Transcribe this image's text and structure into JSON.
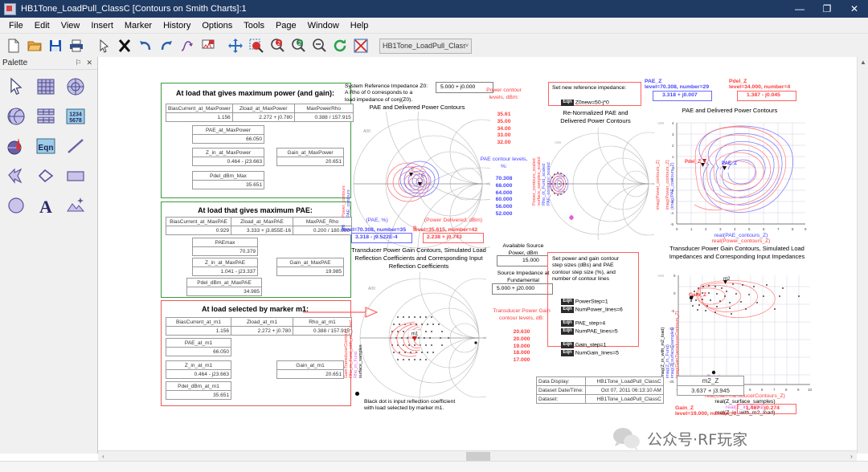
{
  "window": {
    "title": "HB1Tone_LoadPull_ClassC [Contours on Smith Charts]:1",
    "icon": "ads-app-icon",
    "minimize": "—",
    "maximize": "❐",
    "close": "✕"
  },
  "menu": [
    "File",
    "Edit",
    "View",
    "Insert",
    "Marker",
    "History",
    "Options",
    "Tools",
    "Page",
    "Window",
    "Help"
  ],
  "toolbar": {
    "buttons": [
      {
        "name": "new-icon",
        "glyph": "new"
      },
      {
        "name": "open-icon",
        "glyph": "open"
      },
      {
        "name": "save-icon",
        "glyph": "save"
      },
      {
        "name": "print-icon",
        "glyph": "print"
      },
      {
        "name": "select-arrow-icon",
        "glyph": "arrow"
      },
      {
        "name": "delete-icon",
        "glyph": "x"
      },
      {
        "name": "undo-icon",
        "glyph": "undo"
      },
      {
        "name": "redo-icon",
        "glyph": "redo"
      },
      {
        "name": "trace-icon",
        "glyph": "trace"
      },
      {
        "name": "marker-icon",
        "glyph": "marker"
      },
      {
        "name": "pan-icon",
        "glyph": "pan"
      },
      {
        "name": "zoom-area-icon",
        "glyph": "zoomarea"
      },
      {
        "name": "zoom-in-icon",
        "glyph": "zoomin"
      },
      {
        "name": "zoom-out-icon",
        "glyph": "zoomout"
      },
      {
        "name": "zoom-full-icon",
        "glyph": "zoomfull"
      },
      {
        "name": "refresh-icon",
        "glyph": "refresh"
      },
      {
        "name": "stop-icon",
        "glyph": "stop"
      }
    ],
    "dataset_combo": {
      "value": "HB1Tone_LoadPull_ClassC",
      "arrow": "˅"
    }
  },
  "palette": {
    "title": "Palette",
    "pin": "⚐",
    "close": "✕",
    "items": [
      {
        "name": "pointer-tool-icon",
        "glyph": "pointer"
      },
      {
        "name": "rectangular-plot-icon",
        "glyph": "grid"
      },
      {
        "name": "polar-plot-icon",
        "glyph": "polar"
      },
      {
        "name": "smith-chart-icon",
        "glyph": "smith"
      },
      {
        "name": "list-table-icon",
        "glyph": "table"
      },
      {
        "name": "stacked-table-icon",
        "glyph": "digits",
        "label": "1234\n5678"
      },
      {
        "name": "antenna-plot-icon",
        "glyph": "antenna"
      },
      {
        "name": "equation-tool-icon",
        "glyph": "eqn",
        "label": "Eqn"
      },
      {
        "name": "line-tool-icon",
        "glyph": "line"
      },
      {
        "name": "arrow-shape-icon",
        "glyph": "arrowshape"
      },
      {
        "name": "polyline-tool-icon",
        "glyph": "polyline"
      },
      {
        "name": "rectangle-tool-icon",
        "glyph": "rect"
      },
      {
        "name": "ellipse-tool-icon",
        "glyph": "ellipse"
      },
      {
        "name": "text-tool-icon",
        "glyph": "text",
        "label": "A"
      },
      {
        "name": "image-tool-icon",
        "glyph": "image"
      }
    ]
  },
  "doc": {
    "max_power_group": {
      "title": "At load that gives maximum power (and gain):",
      "row1": {
        "headers": [
          "BiasCurrent_at_MaxPower",
          "Zload_at_MaxPower",
          "MaxPowerRho"
        ],
        "values": [
          "1.156",
          "2.272 + j0.780",
          "0.388 / 157.915"
        ]
      },
      "pae": {
        "header": "PAE_at_MaxPower",
        "value": "66.050"
      },
      "zin": {
        "header": "Z_in_at_MaxPower",
        "value": "0.464 - j23.663"
      },
      "gain": {
        "header": "Gain_at_MaxPower",
        "value": "20.651"
      },
      "pdel": {
        "header": "Pdel_dBm_Max",
        "value": "35.651"
      }
    },
    "max_pae_group": {
      "title": "At load that gives maximum PAE:",
      "row1": {
        "headers": [
          "BiasCurrent_at_MaxPAE",
          "Zload_at_MaxPAE",
          "MaxPAE_Rho"
        ],
        "values": [
          "0.929",
          "3.333 + j3.855E-16",
          "0.200 / 180.000"
        ]
      },
      "pae": {
        "header": "PAEmax",
        "value": "70.379"
      },
      "zin": {
        "header": "Z_in_at_MaxPAE",
        "value": "1.041 - j23.337"
      },
      "gain": {
        "header": "Gain_at_MaxPAE",
        "value": "19.985"
      },
      "pdel": {
        "header": "Pdel_dBm_at_MaxPAE",
        "value": "34.985"
      }
    },
    "marker_group": {
      "title": "At load selected by marker m1:",
      "row1": {
        "headers": [
          "BiasCurrent_at_m1",
          "Zload_at_m1",
          "Rho_at_m1"
        ],
        "values": [
          "1.156",
          "2.272 + j0.780",
          "0.388 / 157.915"
        ]
      },
      "pae": {
        "header": "PAE_at_m1",
        "value": "66.050"
      },
      "zin": {
        "header": "Z_in_at_m1",
        "value": "0.464 - j23.663"
      },
      "gain": {
        "header": "Gain_at_m1",
        "value": "20.651"
      },
      "pdel": {
        "header": "Pdel_dBm_at_m1",
        "value": "35.651"
      }
    },
    "z0_note": "System Reference Impedance Z0:\nA Rho of 0 corresponds to a\nload impedance of conj(Z0).",
    "z0_value": "5.000 + j0.000",
    "chart1_title": "PAE and Delivered Power Contours",
    "power_levels_label": "Power\ncontour\nlevels, dBm:",
    "power_levels": [
      "35.61",
      "35.00",
      "34.00",
      "33.00",
      "32.00"
    ],
    "pae_levels_label": "PAE contour\nlevels, %:",
    "pae_levels": [
      "70.308",
      "68.000",
      "64.000",
      "60.000",
      "56.000",
      "52.000"
    ],
    "chart1_ylabels": "Power_contours\nPAE_contours",
    "chart2_vlabels": "Power_contours_scaled\nsurface_samples_scaled\nRho_(it_Fund_scaled\nPAE_contours_scaled",
    "marker_E": {
      "title": "(PAE, %)",
      "tag": "E",
      "level": "level=70.308, number=35",
      "value": "3.318 - j9.522E-4"
    },
    "marker_p": {
      "title": "(Power Delivered, dBm)",
      "tag": "p",
      "level": "level=35.615, number=42",
      "value": "2.238 + j0.743"
    },
    "chart3_title": "Transducer Power Gain Contours,\nSimulated Load Reflection Coefficients and\nCorresponding Input Reflection Coefficients",
    "chart3_vlabels": "GainTransducerContours\nRho_in_Fund_with_m1_Load\nRho_in_Fund\nsurface_samples",
    "blackdot_note": "Black dot is input reflection coefficient\nwith load selected by marker m1.",
    "avail_src_label": "Available Source\nPower, dBm",
    "avail_src_value": "15.000",
    "src_imp_label": "Source Impedance\nat Fundamental",
    "src_imp_value": "5.000 + j20.000",
    "gain_levels_label": "Transducer\nPower Gain\ncontour levels, dB:",
    "gain_levels": [
      "20.630",
      "20.000",
      "19.000",
      "18.000",
      "17.000"
    ],
    "new_ref_label": "Set new reference impedance:",
    "new_ref_eqn": "Z0new=50-j*0",
    "chart2_title": "Re-Normalized PAE and\nDelivered Power Contours",
    "contour_settings_label": "Set power and gain contour\nstep sizes (dBs) and PAE\ncontour step size (%), and\nnumber of contour lines",
    "contour_settings": [
      {
        "eqn": "Eqn",
        "text": "PowerStep=1"
      },
      {
        "eqn": "Eqn",
        "text": "NumPower_lines=6"
      },
      {
        "eqn": "Eqn",
        "text": "PAE_step=4"
      },
      {
        "eqn": "Eqn",
        "text": "NumPAE_lines=5"
      },
      {
        "eqn": "Eqn",
        "text": "Gain_step=1"
      },
      {
        "eqn": "Eqn",
        "text": "NumGain_lines=5"
      }
    ],
    "marker_PAE_Z": {
      "tag": "PAE_Z",
      "level": "level=70.308, number=29",
      "value": "3.318 + j0.007"
    },
    "marker_Pdel_Z": {
      "tag": "Pdel_Z",
      "level": "level=34.000, number=4",
      "value": "1.387 - j0.045"
    },
    "chart4_title": "PAE and Delivered Power Contours",
    "chart4_xlabel": "real(PAE_contours_Z)\nreal(Power_contours_Z)",
    "chart4_ylabel": "imag(Power_contours_Z)\nimag(PAE_contours_Z)",
    "chart4_marker_pdel": "Pdel_Z",
    "chart4_marker_pae": "PAE_Z",
    "chart5_title": "Transducer Power Gain Contours,\nSimulated Load Impedances and\nCorresponding Input Impedances",
    "chart5_xlabel": "real(GainTransducerContours_Z)\nreal(Z_surface_samples)\nreal(Z_in_Fund)\nreal(Z_in_with_m2_load)",
    "chart5_ylabel": "imag(Z_in_with_m2_load)\nimag(Z_in_Fund)\nimag(Z_surface_samples)\nimag(GainTransducerContours_Z)",
    "chart5_marker": "Gain_Z",
    "chart5_m2": "m2",
    "data_display": {
      "rows": [
        {
          "label": "Data Display:",
          "value": "HB1Tone_LoadPull_ClassC"
        },
        {
          "label": "Dataset Date/Time:",
          "value": "Oct 07, 2011  06:13:10 AM"
        },
        {
          "label": "Dataset:",
          "value": "HB1Tone_LoadPull_ClassC"
        }
      ]
    },
    "m2_z": {
      "header": "m2_Z",
      "value": "3.637 + j3.945"
    },
    "gain_z_marker": {
      "tag": "Gain_Z",
      "level": "level=19.000, number=5",
      "value": "1.467 - j0.274"
    },
    "watermark": {
      "icon": "wechat-icon",
      "text": "公众号·RF玩家"
    }
  },
  "chart_data": [
    {
      "type": "scatter",
      "id": "chart4",
      "title": "PAE and Delivered Power Contours",
      "xlabel": "real(PAE_contours_Z) / real(Power_contours_Z)",
      "ylabel": "imag(Power_contours_Z) / imag(PAE_contours_Z)",
      "xlim": [
        0,
        9
      ],
      "ylim": [
        -5,
        4
      ],
      "xticks": [
        0,
        1,
        2,
        3,
        4,
        5,
        6,
        7,
        8,
        9
      ],
      "yticks": [
        -5,
        -4,
        -3,
        -2,
        -1,
        0,
        1,
        2,
        3,
        4
      ],
      "grid": true,
      "markers": [
        {
          "label": "Pdel_Z",
          "x": 1.387,
          "y": -0.045,
          "color": "#ff4040"
        },
        {
          "label": "PAE_Z",
          "x": 3.318,
          "y": 0.007,
          "color": "#4040ff"
        }
      ],
      "series": [
        {
          "name": "PAE_contours_Z",
          "color": "#6a6aff"
        },
        {
          "name": "Power_contours_Z",
          "color": "#ff7070"
        }
      ]
    },
    {
      "type": "scatter",
      "id": "chart5",
      "title": "Transducer Power Gain Contours, Simulated Load Impedances and Corresponding Input Impedances",
      "xlabel": "real(GainTransducerContours_Z) / real(Z_surface_samples) / real(Z_in_Fund) / real(Z_in_with_m2_load)",
      "ylabel": "imag(Z_in_with_m2_load) / imag(Z_in_Fund) / imag(Z_surface_samples) / imag(GainTransducerContours_Z)",
      "xlim": [
        -1,
        10
      ],
      "ylim": [
        -25,
        5
      ],
      "xticks": [
        -1,
        0,
        1,
        2,
        3,
        4,
        5,
        6,
        7,
        8,
        9,
        10
      ],
      "yticks": [
        5,
        0,
        -5,
        -10,
        -15,
        -20,
        -25
      ],
      "grid": true,
      "markers": [
        {
          "label": "Gain_Z",
          "x": 1.467,
          "y": -0.274,
          "color": "#ff4040"
        },
        {
          "label": "m2",
          "x": 3.637,
          "y": 3.945,
          "color": "#000000"
        }
      ]
    }
  ]
}
